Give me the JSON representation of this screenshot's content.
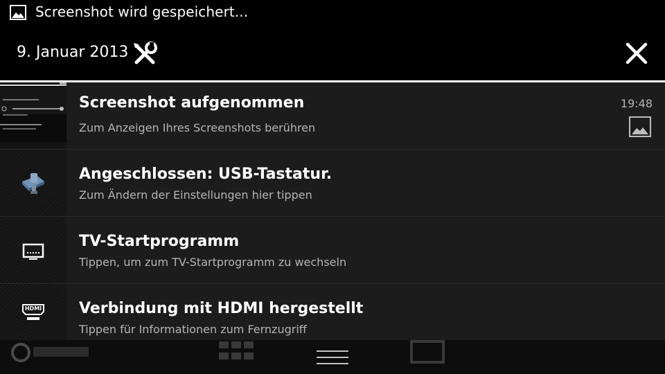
{
  "status_bar": {
    "text": "Screenshot wird gespeichert..."
  },
  "header": {
    "date": "9. Januar 2013"
  },
  "notifications": [
    {
      "title": "Screenshot aufgenommen",
      "subtitle": "Zum Anzeigen Ihres Screenshots berühren",
      "time": "19:48",
      "icon": "screenshot-thumbnail"
    },
    {
      "title": "Angeschlossen: USB-Tastatur.",
      "subtitle": "Zum Ändern der Einstellungen hier tippen",
      "icon": "usb-keyboard-icon"
    },
    {
      "title": "TV-Startprogramm",
      "subtitle": "Tippen, um zum TV-Startprogramm zu wechseln",
      "icon": "tv-icon"
    },
    {
      "title": "Verbindung mit HDMI hergestellt",
      "subtitle": "Tippen für Informationen zum Fernzugriff",
      "icon": "hdmi-icon"
    }
  ],
  "bottom_bar": {
    "icon": "drag-handle-icon"
  },
  "colors": {
    "background": "#000000",
    "notification_bg": "#1c1c1c",
    "text_primary": "#ffffff",
    "text_secondary": "#b5b5b5"
  }
}
